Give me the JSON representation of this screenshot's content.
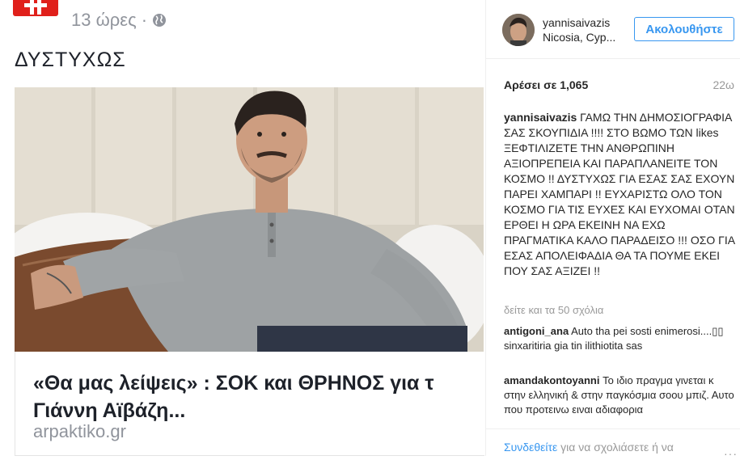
{
  "post": {
    "time_ago": "13 ώρες ·",
    "text": "ΔΥΣΤΥΧΩΣ",
    "link_title_line1": "«Θα μας λείψεις» : ΣΟΚ και ΘΡΗΝΟΣ για τ",
    "link_title_line2": "Γιάννη Αϊβάζη...",
    "link_domain": "arpaktiko.gr",
    "brand_color": "#e0201b"
  },
  "instagram": {
    "username": "yannisaivazis",
    "location": "Nicosia, Cyp...",
    "follow_label": "Ακολουθήστε",
    "likes": "Αρέσει σε 1,065",
    "age": "22ω",
    "caption_user": "yannisaivazis",
    "caption_text": " ΓΑΜΩ ΤΗΝ ΔΗΜΟΣΙΟΓΡΑΦΙΑ ΣΑΣ ΣΚΟΥΠΙΔΙΑ !!!! ΣΤΟ ΒΩΜΟ ΤΩΝ likes ΞΕΦΤΙΛΙΖΕΤΕ ΤΗΝ ΑΝΘΡΩΠΙΝΗ ΑΞΙΟΠΡΕΠΕΙΑ ΚΑΙ ΠΑΡΑΠΛΑΝΕΙΤΕ ΤΟΝ ΚΟΣΜΟ !! ΔΥΣΤΥΧΩΣ ΓΙΑ ΕΣΑΣ ΣΑΣ ΕΧΟΥΝ ΠΑΡΕΙ ΧΑΜΠΑΡΙ !! ΕΥΧΑΡΙΣΤΩ ΟΛΟ ΤΟΝ ΚΟΣΜΟ ΓΙΑ ΤΙΣ ΕΥΧΕΣ ΚΑΙ ΕΥΧΟΜΑΙ ΟΤΑΝ ΕΡΘΕΙ Η ΩΡΑ ΕΚΕΙΝΗ ΝΑ ΕΧΩ ΠΡΑΓΜΑΤΙΚΑ ΚΑΛΟ ΠΑΡΑΔΕΙΣΟ !!! ΟΣΟ ΓΙΑ ΕΣΑΣ ΑΠΟΛΕΙΦΑΔΙΑ ΘΑ ΤΑ ΠΟΥΜΕ ΕΚΕΙ ΠΟΥ ΣΑΣ ΑΞΙΖΕΙ !!",
    "view_all": "δείτε και τα 50 σχόλια",
    "comments": [
      {
        "user": "antigoni_ana",
        "text": " Auto tha pei sosti enimerosi....▯▯ sinxaritiria gia tin ilithiotita sas"
      },
      {
        "user": "amandakontoyanni",
        "text": " Το ιδιο πραγμα γινεται κ στην ελληνική & στην παγκόσμια σοου μπιζ. Αυτο που προτεινω ειναι αδιαφορια"
      }
    ],
    "footer_link": "Συνδεθείτε",
    "footer_text": " για να σχολιάσετε ή να",
    "more": "···",
    "accent_color": "#3897f0"
  }
}
